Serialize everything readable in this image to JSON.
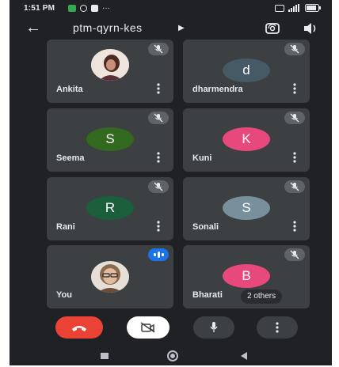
{
  "status_bar": {
    "time": "1:51 PM",
    "dots": "···"
  },
  "header": {
    "meeting_code": "ptm-qyrn-kes"
  },
  "participants": [
    {
      "name": "Ankita",
      "type": "photo",
      "muted": true
    },
    {
      "name": "dharmendra",
      "type": "letter",
      "initial": "d",
      "color": "#455a64",
      "muted": true
    },
    {
      "name": "Seema",
      "type": "letter",
      "initial": "S",
      "color": "#33691e",
      "muted": true
    },
    {
      "name": "Kuni",
      "type": "letter",
      "initial": "K",
      "color": "#e8497d",
      "muted": true
    },
    {
      "name": "Rani",
      "type": "letter",
      "initial": "R",
      "color": "#1b5e3b",
      "muted": true
    },
    {
      "name": "Sonali",
      "type": "letter",
      "initial": "S",
      "color": "#78909c",
      "muted": true
    },
    {
      "name": "You",
      "type": "photo",
      "muted": false,
      "speaking": true
    },
    {
      "name": "Bharati",
      "type": "letter",
      "initial": "B",
      "color": "#e8497d",
      "muted": true,
      "others_label": "2 others"
    }
  ],
  "colors": {
    "background": "#202124",
    "tile": "#3c4043",
    "end_call": "#ea4335",
    "accent": "#1a73e8"
  },
  "controls": [
    "end-call",
    "camera-off",
    "microphone",
    "more-options"
  ],
  "nav": [
    "recents",
    "home",
    "back"
  ]
}
